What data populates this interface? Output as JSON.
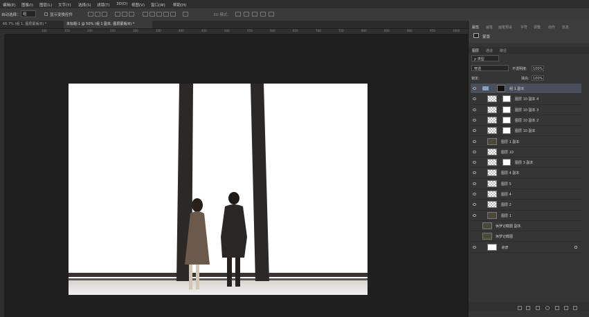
{
  "menubar": {
    "items": [
      "编辑(E)",
      "图像(I)",
      "图层(L)",
      "文字(Y)",
      "选择(S)",
      "滤镜(T)",
      "3D(D)",
      "视图(V)",
      "窗口(W)",
      "帮助(H)"
    ]
  },
  "options": {
    "auto_select_label": "自动选择：",
    "auto_select_value": "组",
    "show_transform": "显示变换控件",
    "mode_3d": "3D 模式："
  },
  "tabs": [
    {
      "label": "66.7% (组 1, 图层蒙版/8) *",
      "active": false
    },
    {
      "label": "未标题-1 @ 50% (组 1 副本, 图层蒙版/8) *",
      "active": true
    }
  ],
  "ruler_numbers": [
    "100",
    "150",
    "200",
    "250",
    "300",
    "350",
    "400",
    "450",
    "500",
    "550",
    "600",
    "650",
    "700",
    "750",
    "800",
    "850",
    "900",
    "950",
    "1000"
  ],
  "panel": {
    "top_tabs": [
      "属性",
      "画笔",
      "画笔预设",
      "字符",
      "调整",
      "动作",
      "信息"
    ],
    "properties_label": "蒙版",
    "layer_tabs": [
      "图层",
      "通道",
      "路径"
    ],
    "kind_label": "ρ 类型",
    "blend_mode": "穿透",
    "opacity_label": "不透明度:",
    "opacity_value": "100%",
    "lock_label": "锁定:",
    "fill_label": "填充:",
    "fill_value": "100%",
    "layers": [
      {
        "name": "组 1 副本",
        "type": "group",
        "selected": true
      },
      {
        "name": "图层 10 副本 4",
        "type": "masked"
      },
      {
        "name": "图层 10 副本 3",
        "type": "masked"
      },
      {
        "name": "图层 10 副本 2",
        "type": "masked"
      },
      {
        "name": "图层 10 副本",
        "type": "masked"
      },
      {
        "name": "图层 1 副本",
        "type": "photo"
      },
      {
        "name": "图层 10",
        "type": "checker"
      },
      {
        "name": "图层 3 副本",
        "type": "masked"
      },
      {
        "name": "图层 4 副本",
        "type": "checker"
      },
      {
        "name": "图层 5",
        "type": "checker"
      },
      {
        "name": "图层 4",
        "type": "checker"
      },
      {
        "name": "图层 2",
        "type": "checker"
      },
      {
        "name": "图层 1",
        "type": "photo"
      },
      {
        "name": "休罗记截图 副本",
        "type": "photo_hidden"
      },
      {
        "name": "休罗记截图",
        "type": "photo_hidden"
      },
      {
        "name": "背景",
        "type": "background"
      }
    ]
  },
  "colors": {
    "ui_dark": "#262626",
    "panel": "#353535",
    "selected_layer": "#4a4f5c"
  }
}
